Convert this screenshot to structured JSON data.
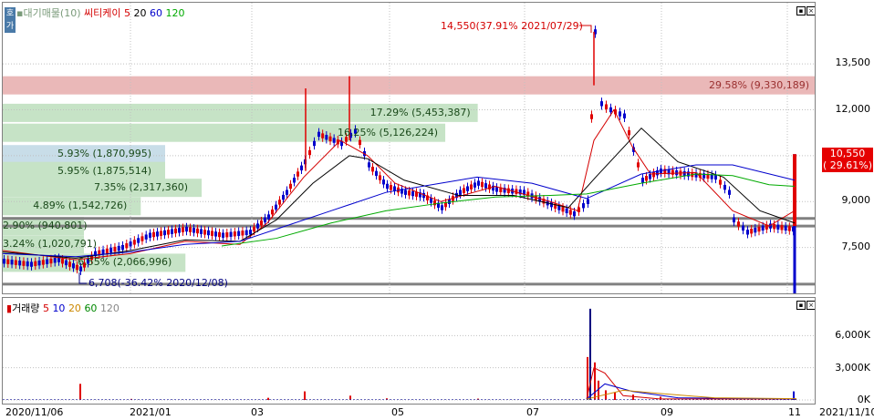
{
  "price_legend": {
    "title": "▪대기매물(10)",
    "stock_name": "씨티케이",
    "ma_items": [
      {
        "label": "5",
        "color": "#d40000"
      },
      {
        "label": "20",
        "color": "#000000"
      },
      {
        "label": "60",
        "color": "#0000cc"
      },
      {
        "label": "120",
        "color": "#00aa00"
      }
    ]
  },
  "side_tab_label": "호가",
  "volume_legend": {
    "title": "거래량",
    "items": [
      {
        "label": "5",
        "color": "#d40000"
      },
      {
        "label": "10",
        "color": "#0000cc"
      },
      {
        "label": "20",
        "color": "#cc8800"
      },
      {
        "label": "60",
        "color": "#008800"
      },
      {
        "label": "120",
        "color": "#888888"
      }
    ]
  },
  "bands": [
    {
      "label": "29.58% (9,330,189)",
      "color": "#eab8b8",
      "price": 12800,
      "width_frac": 1.0
    },
    {
      "label": "17.29% (5,453,387)",
      "color": "#c6e3c6",
      "price": 11900,
      "width_frac": 0.585
    },
    {
      "label": "16.25% (5,126,224)",
      "color": "#c6e3c6",
      "price": 11250,
      "width_frac": 0.545
    },
    {
      "label": "5.93% (1,870,995)",
      "color": "#c8dde8",
      "price": 10550,
      "width_frac": 0.2
    },
    {
      "label": "5.95% (1,875,514)",
      "color": "#c6e3c6",
      "price": 10000,
      "width_frac": 0.2
    },
    {
      "label": "7.35% (2,317,360)",
      "color": "#c6e3c6",
      "price": 9450,
      "width_frac": 0.245
    },
    {
      "label": "4.89% (1,542,726)",
      "color": "#c6e3c6",
      "price": 8850,
      "width_frac": 0.17
    },
    {
      "label": "2.90% (940,801)",
      "color": "#c6e3c6",
      "price": 8200,
      "width_frac": 0.1
    },
    {
      "label": "3.24% (1,020,791)",
      "color": "#c6e3c6",
      "price": 7600,
      "width_frac": 0.1
    },
    {
      "label": "6.55% (2,066,996)",
      "color": "#c6e3c6",
      "price": 7000,
      "width_frac": 0.225
    }
  ],
  "annotations": {
    "high": "14,550(37.91% 2021/07/29)",
    "low": "6,708(-36.42% 2020/12/08)"
  },
  "current_price": {
    "price": "10,550",
    "change": "( 29.61%)"
  },
  "price_axis": [
    "13,500",
    "12,000",
    "10,500",
    "9,000",
    "7,500"
  ],
  "volume_axis": [
    "6,000K",
    "3,000K",
    "0K"
  ],
  "date_axis": [
    "2020/11/06",
    "2021/01",
    "03",
    "05",
    "07",
    "09",
    "11",
    "2021/11/10"
  ],
  "chart_data": {
    "type": "candlestick",
    "ylim": [
      6000,
      15500
    ],
    "x": [
      "2020/11/06",
      "2020/12/08",
      "2021/01",
      "2021/03",
      "2021/05",
      "2021/07",
      "2021/07/29",
      "2021/09",
      "2021/11",
      "2021/11/10"
    ],
    "close": [
      7050,
      6800,
      7800,
      8300,
      9700,
      8600,
      13200,
      10000,
      8150,
      10550
    ],
    "volume_K": [
      40,
      1500,
      40,
      60,
      100,
      50,
      8500,
      300,
      80,
      800
    ]
  },
  "colors": {
    "up": "#e00000",
    "down": "#0000cc",
    "ma5": "#d40000",
    "ma20": "#000000",
    "ma60": "#0000cc",
    "ma120": "#00aa00",
    "support": "#808080"
  }
}
